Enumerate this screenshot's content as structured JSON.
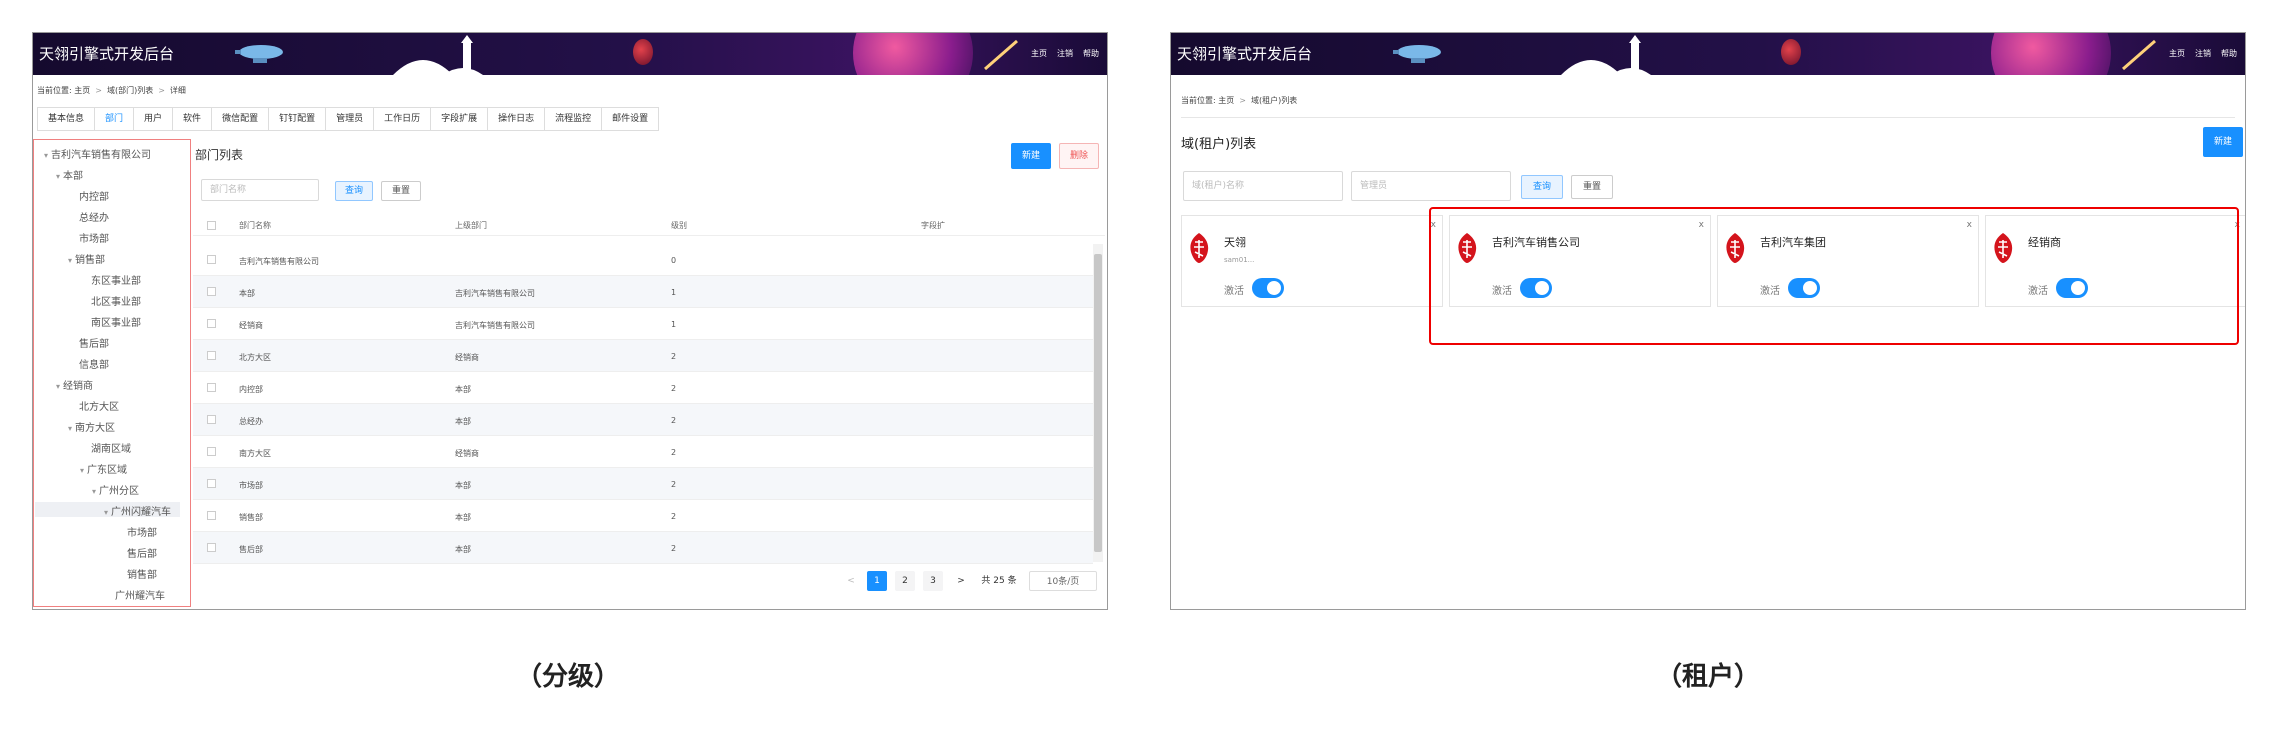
{
  "left": {
    "app_title": "天翎引擎式开发后台",
    "nav": [
      "主页",
      "注销",
      "帮助"
    ],
    "breadcrumb": [
      "当前位置: 主页",
      "域(部门)列表",
      "详细"
    ],
    "tabs": [
      "基本信息",
      "部门",
      "用户",
      "软件",
      "微信配置",
      "钉钉配置",
      "管理员",
      "工作日历",
      "字段扩展",
      "操作日志",
      "流程监控",
      "邮件设置"
    ],
    "active_tab": "部门",
    "tree": [
      {
        "label": "吉利汽车销售有限公司",
        "level": 0,
        "expanded": true
      },
      {
        "label": "本部",
        "level": 1,
        "expanded": true
      },
      {
        "label": "内控部",
        "level": 2
      },
      {
        "label": "总经办",
        "level": 2
      },
      {
        "label": "市场部",
        "level": 2
      },
      {
        "label": "销售部",
        "level": 2,
        "expanded": true
      },
      {
        "label": "东区事业部",
        "level": 3
      },
      {
        "label": "北区事业部",
        "level": 3
      },
      {
        "label": "南区事业部",
        "level": 3
      },
      {
        "label": "售后部",
        "level": 2
      },
      {
        "label": "信息部",
        "level": 2
      },
      {
        "label": "经销商",
        "level": 1,
        "expanded": true
      },
      {
        "label": "北方大区",
        "level": 2
      },
      {
        "label": "南方大区",
        "level": 2,
        "expanded": true
      },
      {
        "label": "湖南区域",
        "level": 3
      },
      {
        "label": "广东区域",
        "level": 3,
        "expanded": true
      },
      {
        "label": "广州分区",
        "level": 4,
        "expanded": true
      },
      {
        "label": "广州闪耀汽车",
        "level": 5,
        "expanded": true,
        "selected": true
      },
      {
        "label": "市场部",
        "level": 6
      },
      {
        "label": "售后部",
        "level": 6
      },
      {
        "label": "销售部",
        "level": 6
      },
      {
        "label": "广州耀汽车",
        "level": 5
      }
    ],
    "section_title": "部门列表",
    "new_label": "新建",
    "delete_label": "删除",
    "search_placeholder": "部门名称",
    "query_label": "查询",
    "reset_label": "重置",
    "columns": [
      "部门名称",
      "上级部门",
      "级别",
      "字段扩"
    ],
    "rows": [
      [
        "吉利汽车销售有限公司",
        "",
        "0"
      ],
      [
        "本部",
        "吉利汽车销售有限公司",
        "1"
      ],
      [
        "经销商",
        "吉利汽车销售有限公司",
        "1"
      ],
      [
        "北方大区",
        "经销商",
        "2"
      ],
      [
        "内控部",
        "本部",
        "2"
      ],
      [
        "总经办",
        "本部",
        "2"
      ],
      [
        "南方大区",
        "经销商",
        "2"
      ],
      [
        "市场部",
        "本部",
        "2"
      ],
      [
        "销售部",
        "本部",
        "2"
      ],
      [
        "售后部",
        "本部",
        "2"
      ]
    ],
    "pagination": {
      "prev": "<",
      "pages": [
        "1",
        "2",
        "3"
      ],
      "current": "1",
      "next": ">",
      "total": "共 25 条",
      "page_size": "10条/页"
    }
  },
  "right": {
    "app_title": "天翎引擎式开发后台",
    "nav": [
      "主页",
      "注销",
      "帮助"
    ],
    "breadcrumb": [
      "当前位置: 主页",
      "域(租户)列表"
    ],
    "section_title": "域(租户)列表",
    "new_label": "新建",
    "name_placeholder": "域(租户)名称",
    "admin_placeholder": "管理员",
    "query_label": "查询",
    "reset_label": "重置",
    "cards": [
      {
        "name": "天翎",
        "sub": "sam01...",
        "status": "激活",
        "active": true
      },
      {
        "name": "吉利汽车销售公司",
        "sub": "",
        "status": "激活",
        "active": true
      },
      {
        "name": "吉利汽车集团",
        "sub": "",
        "status": "激活",
        "active": true
      },
      {
        "name": "经销商",
        "sub": "",
        "status": "激活",
        "active": true
      }
    ],
    "close_symbol": "x"
  },
  "captions": [
    "（分级）",
    "（租户）"
  ],
  "colors": {
    "primary": "#1890ff",
    "danger": "#e55555",
    "highlight": "#e00000",
    "banner": "#231048"
  }
}
